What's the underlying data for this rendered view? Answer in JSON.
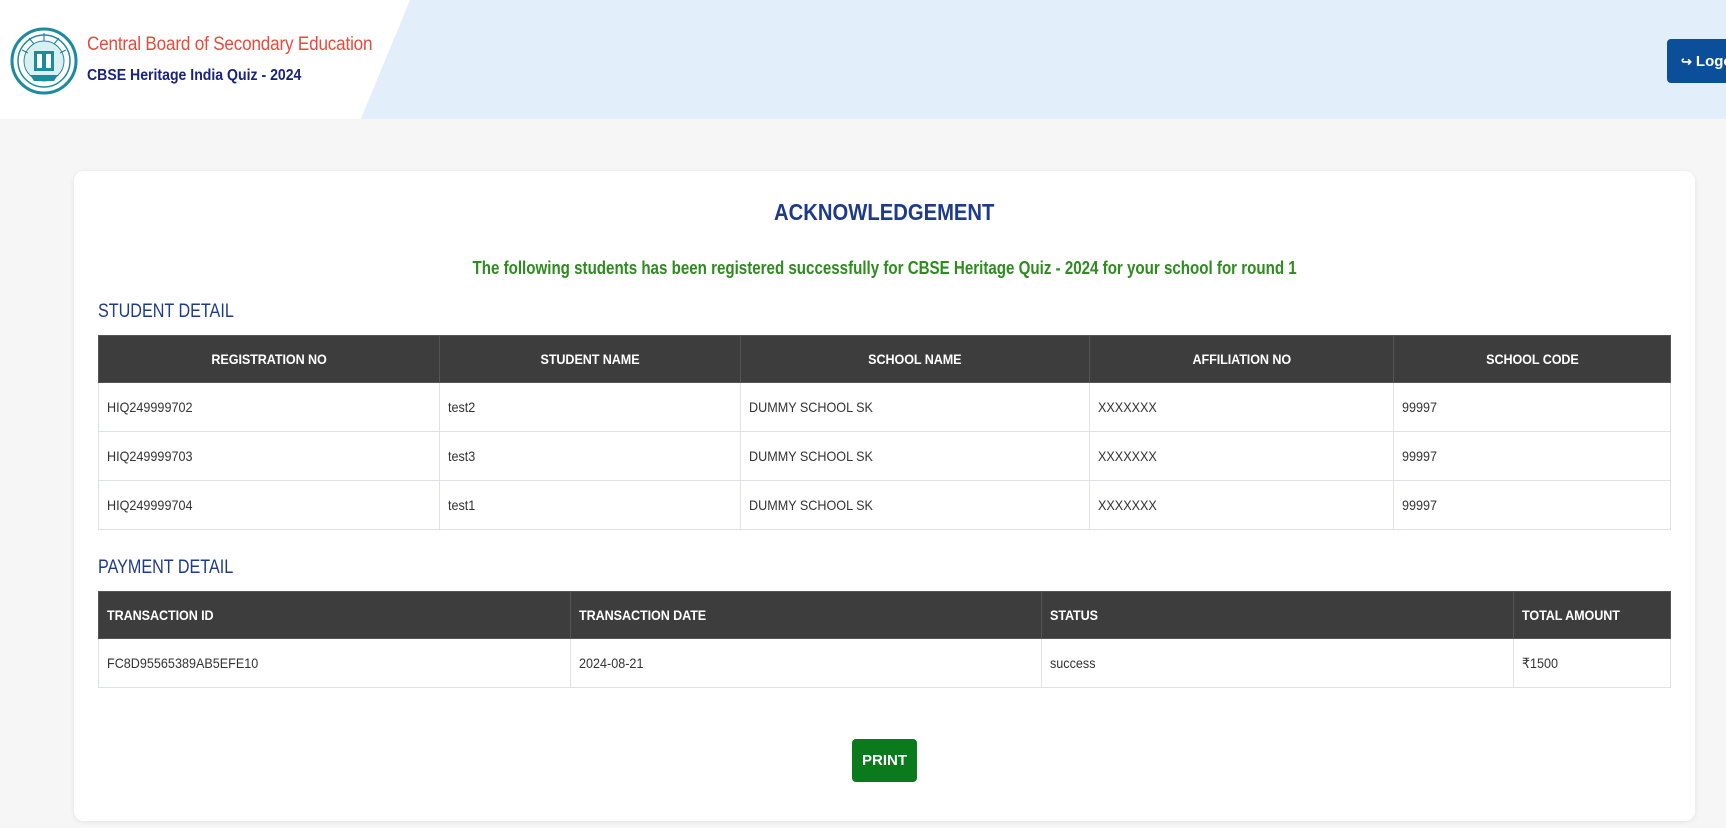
{
  "header": {
    "org_name": "Central Board of Secondary Education",
    "quiz_name": "CBSE Heritage India Quiz - 2024",
    "logout_label": "Logout",
    "colors": {
      "org": "#e64a3c",
      "quiz": "#1a237e",
      "logout_bg": "#0b4f9a",
      "band": "#e3eefb"
    }
  },
  "main": {
    "title": "ACKNOWLEDGEMENT",
    "message": "The following students has been registered successfully for CBSE Heritage Quiz - 2024 for your school for round 1",
    "student_heading": "STUDENT DETAIL",
    "student_columns": [
      "REGISTRATION NO",
      "STUDENT NAME",
      "SCHOOL NAME",
      "AFFILIATION NO",
      "SCHOOL CODE"
    ],
    "students": [
      [
        "HIQ249999702",
        "test2",
        "DUMMY SCHOOL SK",
        "XXXXXXX",
        "99997"
      ],
      [
        "HIQ249999703",
        "test3",
        "DUMMY SCHOOL SK",
        "XXXXXXX",
        "99997"
      ],
      [
        "HIQ249999704",
        "test1",
        "DUMMY SCHOOL SK",
        "XXXXXXX",
        "99997"
      ]
    ],
    "payment_heading": "PAYMENT DETAIL",
    "payment_columns": [
      "TRANSACTION ID",
      "TRANSACTION DATE",
      "STATUS",
      "TOTAL AMOUNT"
    ],
    "payments": [
      [
        "FC8D95565389AB5EFE10",
        "2024-08-21",
        "success",
        "₹1500"
      ]
    ],
    "print_label": "PRINT",
    "colors": {
      "title": "#1e3a8a",
      "message": "#2e8b1f",
      "table_header": "#3d3d3d",
      "print_bg": "#0a7a1d"
    }
  }
}
